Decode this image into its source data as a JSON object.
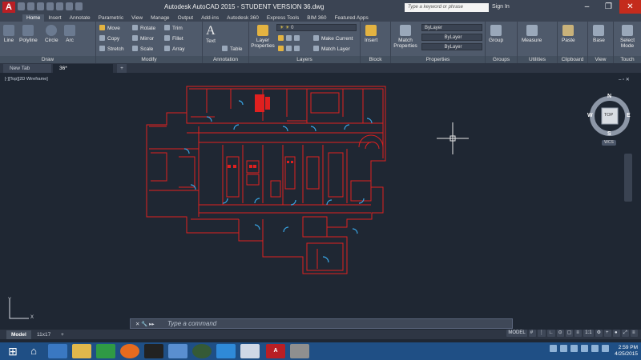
{
  "window": {
    "title": "Autodesk AutoCAD 2015 - STUDENT VERSION     36.dwg",
    "app_button": "A",
    "search_placeholder": "Type a keyword or phrase",
    "sign_in": "Sign In"
  },
  "ribbon_tabs": [
    "Home",
    "Insert",
    "Annotate",
    "Parametric",
    "View",
    "Manage",
    "Output",
    "Add-ins",
    "Autodesk 360",
    "Express Tools",
    "BIM 360",
    "Featured Apps"
  ],
  "active_tab": "Home",
  "panels": {
    "draw": {
      "title": "Draw",
      "line": "Line",
      "polyline": "Polyline",
      "circle": "Circle",
      "arc": "Arc"
    },
    "modify": {
      "title": "Modify",
      "move": "Move",
      "rotate": "Rotate",
      "trim": "Trim",
      "copy": "Copy",
      "mirror": "Mirror",
      "fillet": "Fillet",
      "stretch": "Stretch",
      "scale": "Scale",
      "array": "Array"
    },
    "annotation": {
      "title": "Annotation",
      "text": "Text",
      "table": "Table"
    },
    "layers": {
      "title": "Layers",
      "layer_properties": "Layer Properties",
      "current_layer": "0",
      "make_current": "Make Current",
      "match_layer": "Match Layer"
    },
    "block": {
      "title": "Block",
      "insert": "Insert"
    },
    "properties": {
      "title": "Properties",
      "match_properties": "Match Properties",
      "color": "ByLayer",
      "linetype": "ByLayer",
      "lineweight": "ByLayer"
    },
    "groups": {
      "title": "Groups",
      "group": "Group"
    },
    "utilities": {
      "title": "Utilities",
      "measure": "Measure"
    },
    "clipboard": {
      "title": "Clipboard",
      "paste": "Paste"
    },
    "view": {
      "title": "View",
      "base": "Base"
    },
    "touch": {
      "title": "Touch",
      "select_mode": "Select Mode"
    }
  },
  "file_tabs": [
    "New Tab",
    "36*"
  ],
  "viewport_label": "[-][Top][2D Wireframe]",
  "viewcube": {
    "top": "TOP",
    "n": "N",
    "s": "S",
    "e": "E",
    "w": "W",
    "wcs": "WCS"
  },
  "ucs": {
    "x": "X",
    "y": "Y"
  },
  "command": {
    "prompt": "Type a command",
    "lbl": "✕ 🔧 ▸▸"
  },
  "layout_tabs": [
    "Model",
    "11x17"
  ],
  "status": {
    "model": "MODEL",
    "scale": "1:1"
  },
  "clock": {
    "time": "2:59 PM",
    "date": "4/25/2015"
  },
  "colors": {
    "drawing_lines": "#e0201f",
    "doors": "#39a6e6",
    "background": "#1f2733",
    "ribbon": "#4f5a6b"
  }
}
